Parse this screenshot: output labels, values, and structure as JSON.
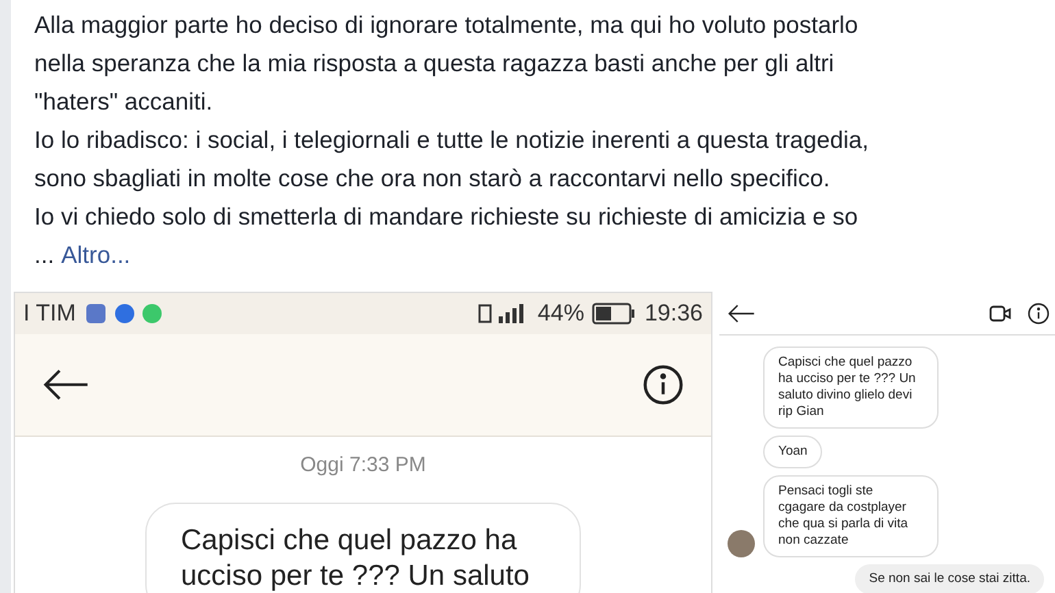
{
  "post": {
    "paragraphs": [
      {
        "lines": [
          "Alla maggior parte ho deciso di ignorare totalmente, ma qui ho voluto postarlo",
          "nella speranza che la mia risposta a questa ragazza basti anche per gli altri",
          "\"haters\" accaniti."
        ]
      },
      {
        "lines": [
          "Io lo ribadisco: i social, i telegiornali e tutte le notizie inerenti a questa tragedia,",
          "sono sbagliati in molte cose che ora non starò a raccontarvi nello specifico."
        ]
      },
      {
        "lines": [
          "Io vi chiedo solo di smetterla di mandare richieste su richieste di amicizia e so"
        ]
      }
    ],
    "ellipsis": "...",
    "more_link": "Altro..."
  },
  "screenshot_left": {
    "status_bar": {
      "carrier": "I TIM",
      "battery": "44%",
      "time": "19:36"
    },
    "date": "Oggi 7:33 PM",
    "messages": [
      {
        "text": "Capisci che quel pazzo ha ucciso per te ??? Un saluto",
        "mine": false
      }
    ]
  },
  "screenshot_right": {
    "messages": [
      {
        "text": "Capisci che quel pazzo ha ucciso per te ??? Un saluto divino glielo devi rip Gian",
        "mine": false,
        "avatar": false
      },
      {
        "text": "Yoan",
        "mine": false,
        "avatar": false
      },
      {
        "text": "Pensaci togli ste cgagare da costplayer che qua si parla di vita non cazzate",
        "mine": false,
        "avatar": true
      },
      {
        "text": "Se non sai le cose stai zitta.",
        "mine": true,
        "avatar": false
      }
    ]
  }
}
